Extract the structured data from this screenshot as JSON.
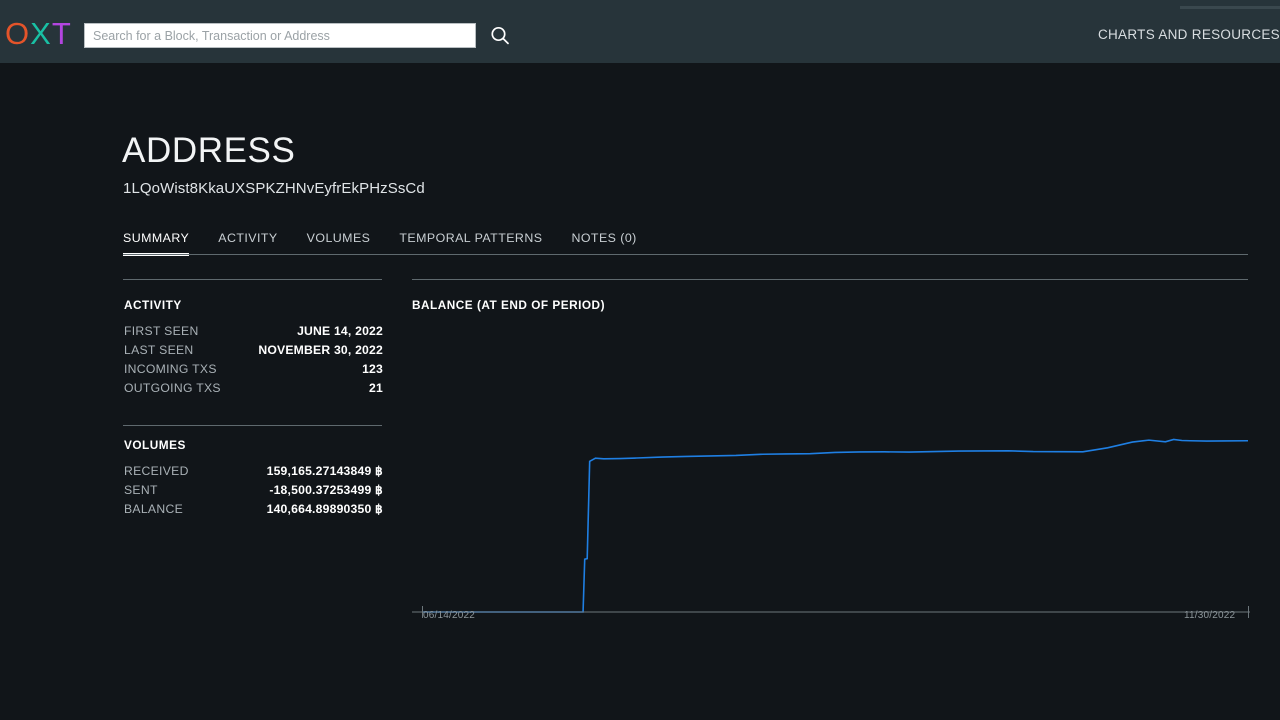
{
  "header": {
    "logo": {
      "o": "O",
      "x": "X",
      "t": "T"
    },
    "search": {
      "placeholder": "Search for a Block, Transaction or Address",
      "value": ""
    },
    "search_icon": "search-icon",
    "nav_link": "CHARTS AND RESOURCES"
  },
  "page": {
    "title": "ADDRESS",
    "subtitle": "1LQoWist8KkaUXSPKZHNvEyfrEkPHzSsCd"
  },
  "tabs": [
    {
      "label": "SUMMARY",
      "active": true
    },
    {
      "label": "ACTIVITY",
      "active": false
    },
    {
      "label": "VOLUMES",
      "active": false
    },
    {
      "label": "TEMPORAL PATTERNS",
      "active": false
    },
    {
      "label": "NOTES (0)",
      "active": false
    }
  ],
  "activity": {
    "heading": "ACTIVITY",
    "rows": [
      {
        "key": "FIRST SEEN",
        "value": "JUNE 14, 2022"
      },
      {
        "key": "LAST SEEN",
        "value": "NOVEMBER 30, 2022"
      },
      {
        "key": "INCOMING TXS",
        "value": "123"
      },
      {
        "key": "OUTGOING TXS",
        "value": "21"
      }
    ]
  },
  "volumes": {
    "heading": "VOLUMES",
    "rows": [
      {
        "key": "RECEIVED",
        "value": "159,165.27143849 ฿"
      },
      {
        "key": "SENT",
        "value": "-18,500.37253499 ฿"
      },
      {
        "key": "BALANCE",
        "value": "140,664.89890350 ฿"
      }
    ]
  },
  "chart_data": {
    "type": "line",
    "title": "BALANCE (AT END OF PERIOD)",
    "xlabel": "",
    "ylabel": "",
    "grid": false,
    "legend": false,
    "line_color": "#1f7fe3",
    "x_tick_labels": [
      "06/14/2022",
      "11/30/2022"
    ],
    "xlim": [
      "06/14/2022",
      "11/30/2022"
    ],
    "ylim": [
      0,
      160000
    ],
    "series": [
      {
        "name": "Balance",
        "x": [
          0,
          4,
          19.5,
          19.7,
          20.0,
          20.3,
          21,
          22,
          24,
          26,
          29,
          32,
          35,
          38,
          41,
          44,
          47,
          50,
          53,
          56,
          59,
          62,
          65,
          68,
          71,
          74,
          77,
          80,
          83,
          86,
          88,
          90,
          91,
          92,
          93,
          95,
          97,
          100
        ],
        "y": [
          0,
          0,
          0,
          41000,
          41500,
          117000,
          119500,
          119000,
          119200,
          119600,
          120300,
          120800,
          121200,
          121600,
          122500,
          122800,
          123000,
          123900,
          124300,
          124400,
          124200,
          124600,
          125000,
          125100,
          125200,
          124600,
          124500,
          124400,
          127500,
          132000,
          133500,
          132200,
          134000,
          133200,
          133000,
          132800,
          132900,
          133000
        ]
      }
    ]
  }
}
